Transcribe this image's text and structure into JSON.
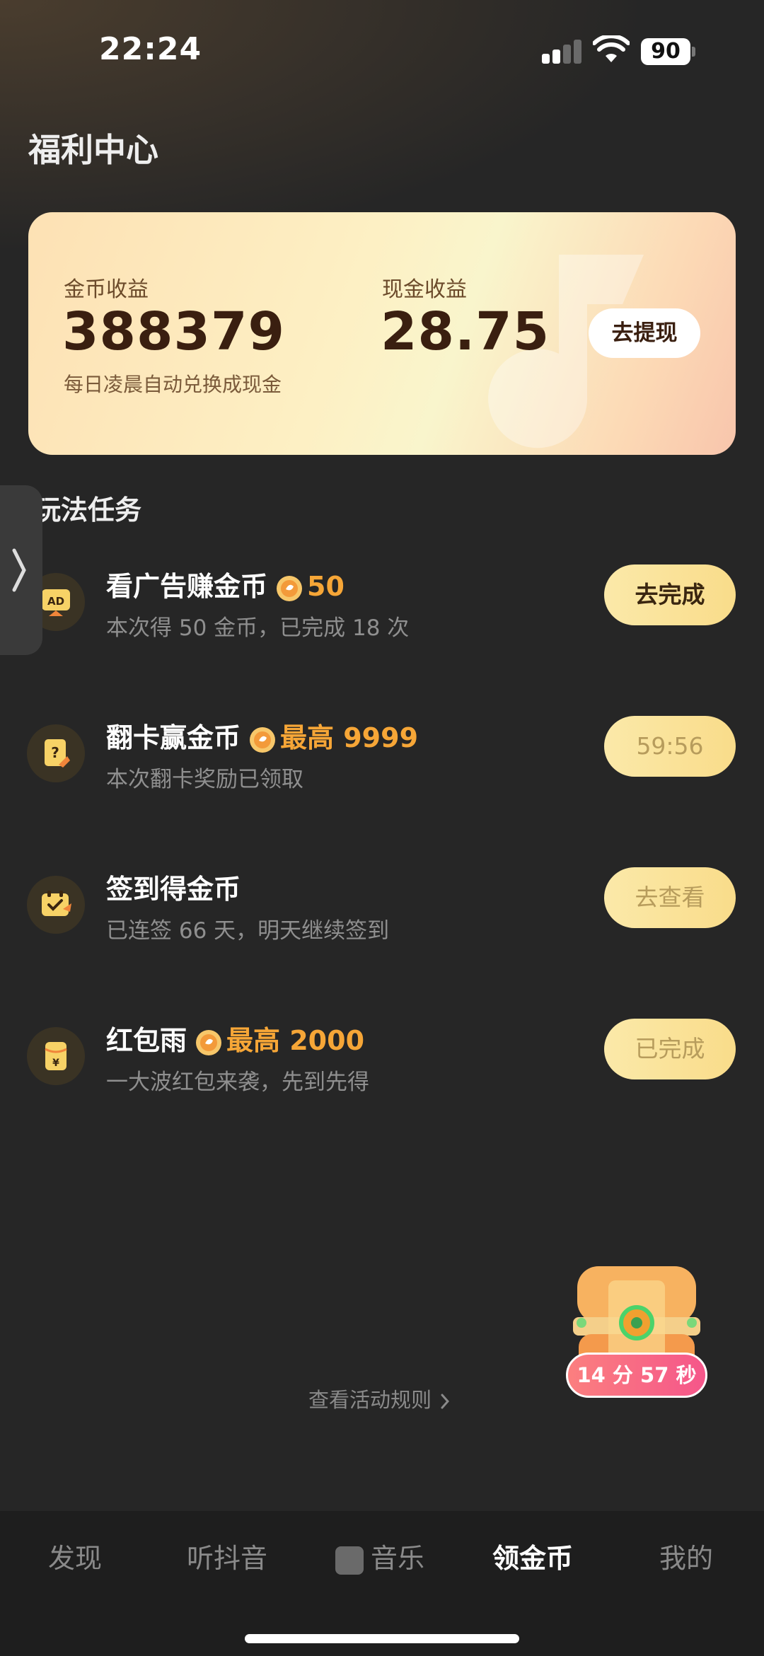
{
  "status_bar": {
    "time": "22:24",
    "battery": "90"
  },
  "page_title": "福利中心",
  "earnings": {
    "coin_label": "金币收益",
    "coin_value": "388379",
    "coin_note": "每日凌晨自动兑换成现金",
    "cash_label": "现金收益",
    "cash_value": "28.75",
    "withdraw_label": "去提现"
  },
  "section_title": "玩法任务",
  "tasks": [
    {
      "title": "看广告赚金币",
      "reward": "50",
      "subtitle": "本次得 50 金币，已完成 18 次",
      "button": "去完成",
      "icon": "ad-icon"
    },
    {
      "title": "翻卡赢金币",
      "reward": "最高 9999",
      "subtitle": "本次翻卡奖励已领取",
      "button": "59:56",
      "icon": "card-flip-icon"
    },
    {
      "title": "签到得金币",
      "reward": "",
      "subtitle": "已连签 66 天，明天继续签到",
      "button": "去查看",
      "icon": "checkin-icon"
    },
    {
      "title": "红包雨",
      "reward": "最高 2000",
      "subtitle": "一大波红包来袭，先到先得",
      "button": "已完成",
      "icon": "red-packet-icon"
    }
  ],
  "treasure": {
    "timer": "14 分 57 秒"
  },
  "rules_link": "查看活动规则",
  "nav": {
    "items": [
      "发现",
      "听抖音",
      "音乐",
      "领金币",
      "我的"
    ],
    "active_index": 3
  },
  "colors": {
    "accent": "#f6a637",
    "button": "#fbe9a9",
    "background": "#262626"
  }
}
